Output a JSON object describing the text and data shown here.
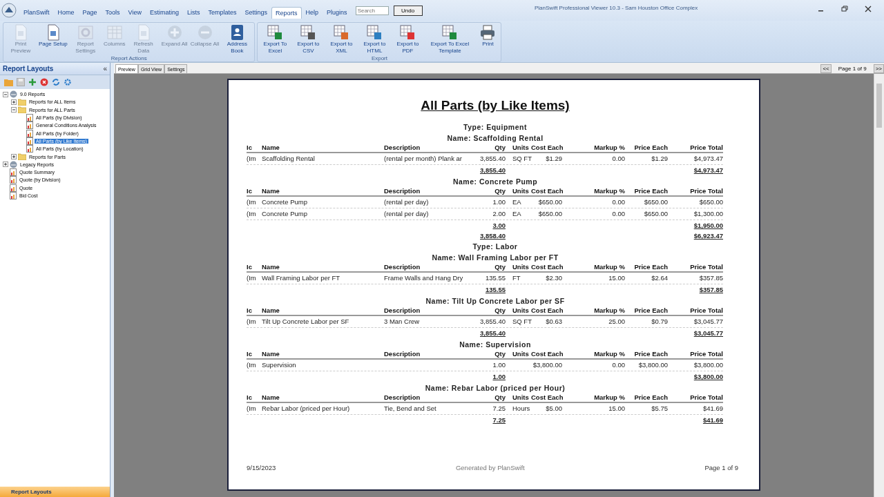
{
  "window": {
    "title": "PlanSwift Professional Viewer 10.3 - Sam Houston Office Complex"
  },
  "menu_tabs": [
    {
      "label": "PlanSwift",
      "selected": false
    },
    {
      "label": "Home",
      "selected": false
    },
    {
      "label": "Page",
      "selected": false
    },
    {
      "label": "Tools",
      "selected": false
    },
    {
      "label": "View",
      "selected": false
    },
    {
      "label": "Estimating",
      "selected": false
    },
    {
      "label": "Lists",
      "selected": false
    },
    {
      "label": "Templates",
      "selected": false
    },
    {
      "label": "Settings",
      "selected": false
    },
    {
      "label": "Reports",
      "selected": true
    },
    {
      "label": "Help",
      "selected": false
    },
    {
      "label": "Plugins",
      "selected": false
    }
  ],
  "search": {
    "placeholder": "Search"
  },
  "undo_button": "Undo",
  "ribbon_groups": [
    {
      "title": "Report Actions",
      "buttons": [
        {
          "label": "Print Preview",
          "disabled": true
        },
        {
          "label": "Page Setup",
          "disabled": false
        },
        {
          "label": "Report Settings",
          "disabled": true
        },
        {
          "label": "Columns",
          "disabled": true
        },
        {
          "label": "Refresh Data",
          "disabled": true
        },
        {
          "label": "Expand All",
          "disabled": true
        },
        {
          "label": "Collapse All",
          "disabled": true
        },
        {
          "label": "Address Book",
          "disabled": false
        }
      ]
    },
    {
      "title": "Export",
      "buttons": [
        {
          "label": "Export To Excel",
          "disabled": false
        },
        {
          "label": "Export to CSV",
          "disabled": false
        },
        {
          "label": "Export to XML",
          "disabled": false
        },
        {
          "label": "Export to HTML",
          "disabled": false
        },
        {
          "label": "Export to PDF",
          "disabled": false
        },
        {
          "label": "Export To Excel Template",
          "disabled": false
        },
        {
          "label": "Print",
          "disabled": false
        }
      ]
    }
  ],
  "sidebar": {
    "title": "Report Layouts",
    "collapse": "«",
    "footer": "Report Layouts",
    "tree": [
      {
        "label": "9.0 Reports",
        "kind": "group",
        "expanded": true,
        "selected": false,
        "children": [
          {
            "label": "Reports for ALL Items",
            "kind": "folder",
            "expanded": false,
            "selected": false
          },
          {
            "label": "Reports for ALL Parts",
            "kind": "folder",
            "expanded": true,
            "selected": false,
            "children": [
              {
                "label": "All Parts (by Division)",
                "kind": "report",
                "selected": false
              },
              {
                "label": "General Conditions Analysis",
                "kind": "report",
                "selected": false
              },
              {
                "label": "All Parts (by Folder)",
                "kind": "report",
                "selected": false
              },
              {
                "label": "All Parts (by Like Items)",
                "kind": "report",
                "selected": true
              },
              {
                "label": "All Parts (by Location)",
                "kind": "report",
                "selected": false
              }
            ]
          },
          {
            "label": "Reports for Parts",
            "kind": "folder",
            "expanded": false,
            "selected": false
          }
        ]
      },
      {
        "label": "Legacy Reports",
        "kind": "group",
        "expanded": false,
        "selected": false
      },
      {
        "label": "Quote Summary",
        "kind": "report",
        "selected": false
      },
      {
        "label": "Quote (by Division)",
        "kind": "report",
        "selected": false
      },
      {
        "label": "Quote",
        "kind": "report",
        "selected": false
      },
      {
        "label": "Bid Cost",
        "kind": "report",
        "selected": false
      }
    ]
  },
  "view_tabs": [
    {
      "label": "Preview",
      "selected": true
    },
    {
      "label": "Grid View",
      "selected": false
    },
    {
      "label": "Settings",
      "selected": false
    }
  ],
  "pager": {
    "prev": "<<",
    "page": "Page 1 of 9",
    "next": ">>"
  },
  "report": {
    "title": "All Parts (by Like Items)",
    "sections": [
      {
        "kind": "type",
        "text": "Type: Equipment"
      },
      {
        "kind": "group",
        "name": "Name: Scaffolding Rental",
        "columns": [
          "Ic",
          "Name",
          "Description",
          "Qty",
          "Units",
          "Cost Each",
          "Markup %",
          "Price Each",
          "Price Total"
        ],
        "rows": [
          [
            "(Im",
            "Scaffolding Rental",
            "(rental per month) Plank ar",
            "3,855.40",
            "SQ FT",
            "$1.29",
            "0.00",
            "$1.29",
            "$4,973.47"
          ]
        ],
        "qty_total": "3,855.40",
        "price_total": "$4,973.47"
      },
      {
        "kind": "group",
        "name": "Name: Concrete Pump",
        "columns": [
          "Ic",
          "Name",
          "Description",
          "Qty",
          "Units",
          "Cost Each",
          "Markup %",
          "Price Each",
          "Price Total"
        ],
        "rows": [
          [
            "(Im",
            "Concrete Pump",
            "(rental per day)",
            "1.00",
            "EA",
            "$650.00",
            "0.00",
            "$650.00",
            "$650.00"
          ],
          [
            "(Im",
            "Concrete Pump",
            "(rental per day)",
            "2.00",
            "EA",
            "$650.00",
            "0.00",
            "$650.00",
            "$1,300.00"
          ]
        ],
        "qty_total": "3.00",
        "price_total": "$1,950.00"
      },
      {
        "kind": "type_total",
        "qty_total": "3,858.40",
        "price_total": "$6,923.47"
      },
      {
        "kind": "type",
        "text": "Type: Labor"
      },
      {
        "kind": "group",
        "name": "Name: Wall Framing Labor per FT",
        "columns": [
          "Ic",
          "Name",
          "Description",
          "Qty",
          "Units",
          "Cost Each",
          "Markup %",
          "Price Each",
          "Price Total"
        ],
        "rows": [
          [
            "(Im",
            "Wall Framing Labor per FT",
            "Frame Walls and Hang Dry",
            "135.55",
            "FT",
            "$2.30",
            "15.00",
            "$2.64",
            "$357.85"
          ]
        ],
        "qty_total": "135.55",
        "price_total": "$357.85"
      },
      {
        "kind": "group",
        "name": "Name: Tilt Up Concrete Labor per SF",
        "columns": [
          "Ic",
          "Name",
          "Description",
          "Qty",
          "Units",
          "Cost Each",
          "Markup %",
          "Price Each",
          "Price Total"
        ],
        "rows": [
          [
            "(Im",
            "Tilt Up Concrete Labor per SF",
            "3 Man Crew",
            "3,855.40",
            "SQ FT",
            "$0.63",
            "25.00",
            "$0.79",
            "$3,045.77"
          ]
        ],
        "qty_total": "3,855.40",
        "price_total": "$3,045.77"
      },
      {
        "kind": "group",
        "name": "Name: Supervision",
        "columns": [
          "Ic",
          "Name",
          "Description",
          "Qty",
          "Units",
          "Cost Each",
          "Markup %",
          "Price Each",
          "Price Total"
        ],
        "rows": [
          [
            "(Im",
            "Supervision",
            "",
            "1.00",
            "",
            "$3,800.00",
            "0.00",
            "$3,800.00",
            "$3,800.00"
          ]
        ],
        "qty_total": "1.00",
        "price_total": "$3,800.00"
      },
      {
        "kind": "group",
        "name": "Name: Rebar Labor (priced per Hour)",
        "columns": [
          "Ic",
          "Name",
          "Description",
          "Qty",
          "Units",
          "Cost Each",
          "Markup %",
          "Price Each",
          "Price Total"
        ],
        "rows": [
          [
            "(Im",
            "Rebar Labor (priced per Hour)",
            "Tie, Bend and Set",
            "7.25",
            "Hours",
            "$5.00",
            "15.00",
            "$5.75",
            "$41.69"
          ]
        ],
        "qty_total": "7.25",
        "price_total": "$41.69"
      }
    ],
    "footer": {
      "date": "9/15/2023",
      "generator": "Generated by PlanSwift",
      "page": "Page 1 of 9"
    }
  }
}
